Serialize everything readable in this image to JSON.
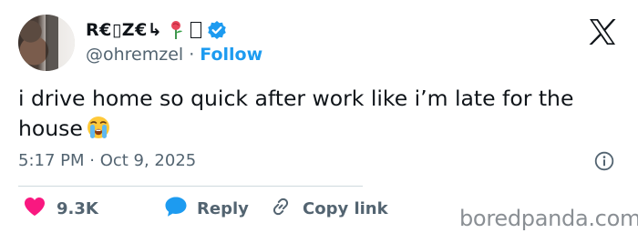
{
  "author": {
    "display_name": "R€▯Z€↳",
    "handle": "@ohremzel",
    "separator": "·",
    "follow_label": "Follow",
    "verified": true,
    "emoji_icons": [
      "rose-icon",
      "box-glyph"
    ]
  },
  "platform_logo": "x-logo",
  "tweet": {
    "text": "i drive home so quick after work like i’m late for the house",
    "emoji": "loudly-crying-face-icon"
  },
  "meta": {
    "timestamp": "5:17 PM · Oct 9, 2025"
  },
  "actions": {
    "likes": "9.3K",
    "reply_label": "Reply",
    "copy_link_label": "Copy link"
  },
  "watermark": "boredpanda.com",
  "colors": {
    "accent": "#1d9bf0",
    "like": "#f91880",
    "reply": "#1d9bf0",
    "text_primary": "#0f1419",
    "text_secondary": "#536471",
    "divider": "#cfd9de",
    "watermark": "#8a8f94"
  }
}
